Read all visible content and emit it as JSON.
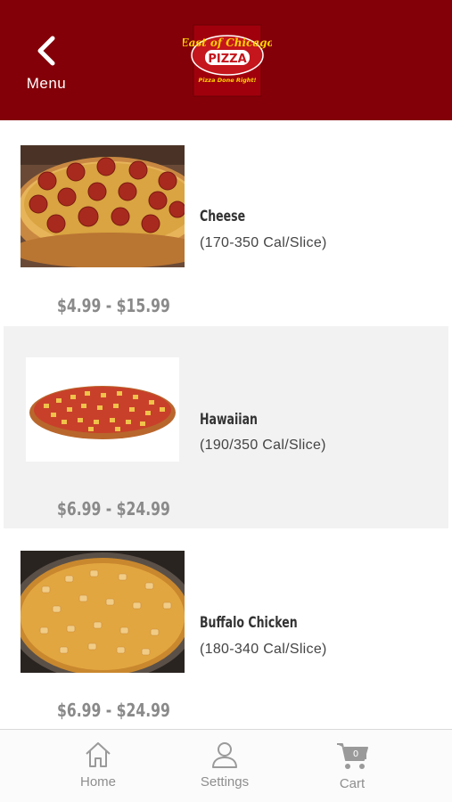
{
  "header": {
    "back_label": "Menu",
    "brand_line1": "East of Chicago",
    "brand_line2": "PIZZA",
    "brand_tagline": "Pizza Done Right!",
    "brand_color": "#840008"
  },
  "items": [
    {
      "name": "Cheese",
      "calories": "(170-350 Cal/Slice)",
      "price": "$4.99 - $15.99",
      "image": "pepperoni-pizza"
    },
    {
      "name": "Hawaiian",
      "calories": "(190/350 Cal/Slice)",
      "price": "$6.99 - $24.99",
      "image": "hawaiian-pizza"
    },
    {
      "name": "Buffalo Chicken",
      "calories": "(180-340 Cal/Slice)",
      "price": "$6.99 - $24.99",
      "image": "buffalo-chicken-pizza"
    }
  ],
  "tabbar": {
    "home_label": "Home",
    "settings_label": "Settings",
    "cart_label": "Cart",
    "cart_count": "0",
    "icons": [
      "home-icon",
      "user-icon",
      "cart-icon"
    ]
  }
}
